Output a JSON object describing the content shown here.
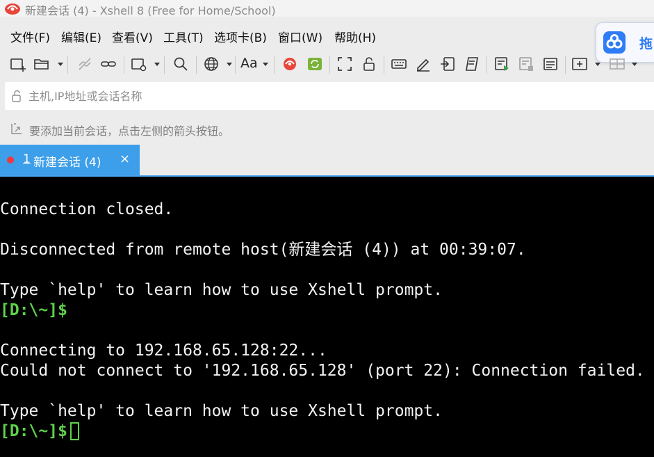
{
  "window": {
    "title": "新建会话 (4) - Xshell 8 (Free for Home/School)"
  },
  "menu": {
    "file": "文件(F)",
    "edit": "编辑(E)",
    "view": "查看(V)",
    "tools": "工具(T)",
    "tabs": "选项卡(B)",
    "window": "窗口(W)",
    "help": "帮助(H)"
  },
  "baidu_widget": {
    "label": "拖"
  },
  "toolbar": {
    "font_label": "Aa"
  },
  "address_bar": {
    "placeholder": "主机,IP地址或会话名称"
  },
  "hint_bar": {
    "text": "要添加当前会话，点击左侧的箭头按钮。"
  },
  "tab": {
    "number": "1",
    "label": "新建会话 (4)",
    "close": "×"
  },
  "terminal": {
    "lines": [
      "Connection closed.",
      "Disconnected from remote host(新建会话 (4)) at 00:39:07.",
      "Type `help' to learn how to use Xshell prompt.",
      "Connecting to 192.168.65.128:22...",
      "Could not connect to '192.168.65.128' (port 22): Connection failed.",
      "Type `help' to learn how to use Xshell prompt."
    ],
    "prompt": "[D:\\~]$"
  },
  "colors": {
    "tab_active": "#3d9ee9",
    "prompt_green": "#5ed14b",
    "terminal_bg": "#000000",
    "session_dot": "#f0383d"
  }
}
